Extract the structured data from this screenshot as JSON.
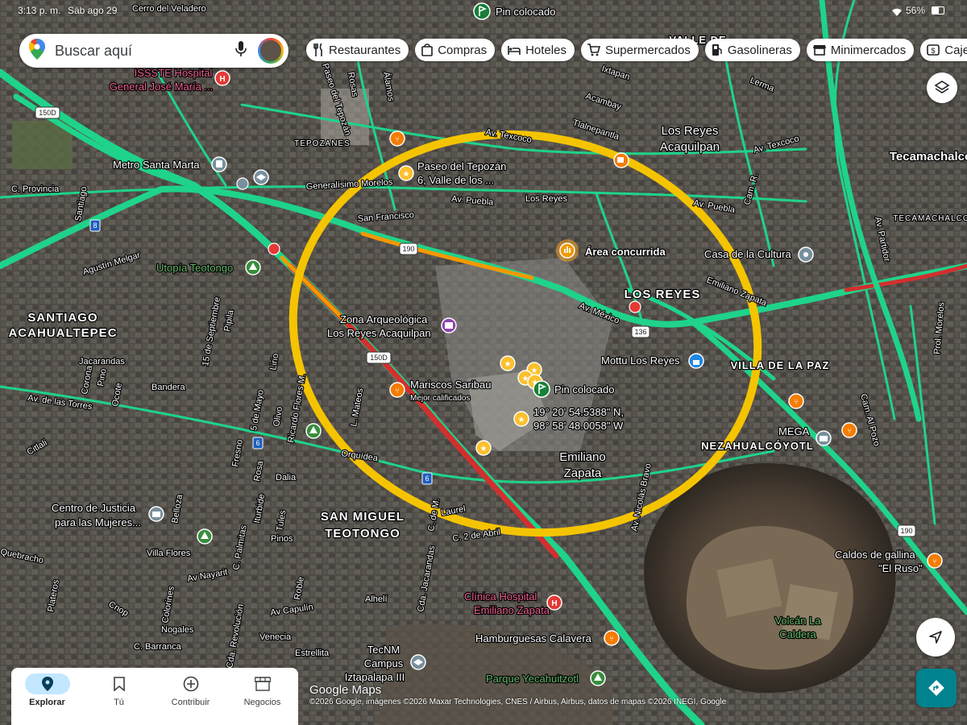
{
  "status": {
    "time": "3:13 p. m.",
    "date": "Sáb ago 29",
    "battery": "56%"
  },
  "search": {
    "placeholder": "Buscar aquí"
  },
  "chips": [
    "Restaurantes",
    "Compras",
    "Hoteles",
    "Supermercados",
    "Gasolineras",
    "Minimercados",
    "Caje"
  ],
  "colors": {
    "highlight_ring": "#f5c400",
    "traffic_green": "#1fd38a",
    "traffic_orange": "#f29900",
    "traffic_red": "#d32f2f",
    "bottom_nav_active": "#c2e7ff",
    "directions_button": "#00838f"
  },
  "pin": {
    "title": "Pin colocado",
    "coordinates_line1": "19° 20' 54.5388\" N,",
    "coordinates_line2": "98° 58' 48.0058\" W"
  },
  "pin_top": "Pin colocado",
  "busy_area": "Área concurrida",
  "places": {
    "issste": "ISSSTE Hospital",
    "issste2": "General José María ...",
    "metro": "Metro Santa Marta",
    "paseo": "Paseo del Tepozán",
    "paseo2": "6, Valle de los ...",
    "zona": "Zona Arqueológica",
    "zona2": "Los Reyes Acaquilpan",
    "mariscos": "Mariscos Saribau",
    "mariscos_sub": "Mejor calificados",
    "mottu": "Mottu Los Reyes",
    "casa_cultura": "Casa de la Cultura",
    "utopia": "Utopía Teotongo",
    "centro_justicia": "Centro de Justicia",
    "centro_justicia2": "para las Mujeres...",
    "clinica": "Clínica Hospital",
    "clinica2": "Emiliano Zapata",
    "hamburguesas": "Hamburguesas Calavera",
    "tecnm": "TecNM",
    "tecnm2": "Campus",
    "tecnm3": "Iztapalapa III",
    "parque": "Parque Yecahuitzotl",
    "volcan": "Volcán La",
    "volcan2": "Caldera",
    "mega": "MEGA",
    "caldos": "Caldos de gallina",
    "caldos2": "\"El Ruso\""
  },
  "areas": {
    "santiago": "SANTIAGO",
    "santiago2": "ACAHUALTEPEC",
    "los_reyes": "LOS REYES",
    "los_reyes_aca": "Los Reyes",
    "los_reyes_aca2": "Acaquilpan",
    "san_miguel": "SAN MIGUEL",
    "san_miguel2": "TEOTONGO",
    "villa_paz": "VILLA DE LA PAZ",
    "neza": "NEZAHUALCÓYOTL",
    "emiliano": "Emiliano",
    "emiliano2": "Zapata",
    "tecamachalco": "Tecamachalco",
    "tecamachalco2": "TECAMACHALCO",
    "tepozanes": "TEPOZANES",
    "valle": "VALLE DE"
  },
  "streets": {
    "generalisimo": "Generalísimo Morelos",
    "av_puebla": "Av. Puebla",
    "av_puebla2": "Av. Puebla",
    "los_reyes_st": "Los Reyes",
    "san_francisco": "San Francisco",
    "av_mexico": "Av. México",
    "av_texcoco": "Av. Texcoco",
    "av_texcoco2": "Av. Texcoco",
    "agustin": "Agustín Melgar",
    "av_torres": "Av. de las Torres",
    "c_provincia": "C. Provincia",
    "santiago_st": "Santiago",
    "jacarandas": "Jacarandas",
    "bandera": "Bandera",
    "orquidea": "Orquídea",
    "dalia": "Dalia",
    "laurel": "Laurel",
    "abril": "C. 2 de Abril",
    "quebracho": "Quebracho",
    "villa_flores": "Villa Flores",
    "av_nayarit": "Av Nayarit",
    "av_capulin": "Av Capulín",
    "venecia": "Venecia",
    "estrellita": "Estrellita",
    "nogales": "Nogales",
    "c_barranca": "C. Barranca",
    "alheli": "Alhelí",
    "pinos": "Pinos",
    "sept": "15 de Septiembre",
    "ricardo": "Ricardo Flores M.",
    "av_nicolas": "Av. Nicolás Bravo",
    "cam_pozo": "Cam. Al Pozo",
    "prol_morelos": "Prol. Morelos",
    "av_partidor": "Av. Partidor",
    "cam_r": "Cam. R.",
    "paseo_tepozan": "Paseo del Tepozán",
    "tlalnepantla": "Tlalnepantla",
    "acambay": "Acambay",
    "ixtapan": "Ixtapan",
    "lerma": "Lerma",
    "cerro": "Cerro del Veladero",
    "alamos": "Álamos",
    "rosas": "Rosas",
    "emiliano_st": "Emiliano Zapata",
    "mateos": "L. Mateos",
    "pipila": "Pipila",
    "lirio": "Lirio",
    "olivo": "Olivo",
    "corona": "Corona",
    "pino": "Pino",
    "ocote": "Ocote",
    "citlali": "Citlali",
    "platanos": "Plateros",
    "cnop": "Cnop",
    "colorines": "Colorines",
    "revolucion": "Cda. Revolución",
    "c_palmitas": "C. Palmitas",
    "iturbide": "Iturbide",
    "rosa": "Rosa",
    "tules": "Tules",
    "fresno": "Fresno",
    "roble": "Roble",
    "cda_jacarandas": "Cda. Jacarandas",
    "belloza": "Belloza",
    "mayo": "5 de Mayo",
    "c_de_m": "C. de M."
  },
  "shields": {
    "r150d": "150D",
    "r150d_b": "150D",
    "r190": "190",
    "r190_b": "190",
    "r136": "136",
    "r8": "8",
    "r6": "6",
    "r6_b": "6"
  },
  "nav": [
    {
      "label": "Explorar",
      "icon": "explore-pin-icon",
      "active": true
    },
    {
      "label": "Tú",
      "icon": "bookmark-icon",
      "active": false
    },
    {
      "label": "Contribuir",
      "icon": "add-circle-icon",
      "active": false
    },
    {
      "label": "Negocios",
      "icon": "storefront-icon",
      "active": false
    }
  ],
  "google_logo": "Google Maps",
  "copyright": "©2026 Google, imágenes ©2026 Maxar Technologies, CNES / Airbus, Airbus, datos de mapas ©2026 INEGI, Google"
}
